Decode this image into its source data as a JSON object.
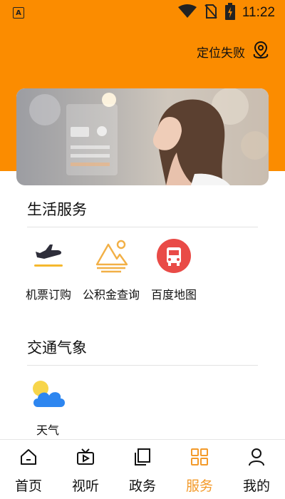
{
  "status_bar": {
    "time": "11:22",
    "left_icon": "A",
    "icons": [
      "wifi-icon",
      "no-sim-icon",
      "battery-charging-icon"
    ]
  },
  "header": {
    "location_text": "定位失败",
    "location_icon": "map-pin-icon"
  },
  "banner": {
    "description": "weather promotional banner with woman"
  },
  "sections": [
    {
      "title": "生活服务",
      "items": [
        {
          "label": "机票订购",
          "icon": "airplane-icon"
        },
        {
          "label": "公积金查询",
          "icon": "mountain-sun-icon"
        },
        {
          "label": "百度地图",
          "icon": "bus-icon"
        }
      ]
    },
    {
      "title": "交通气象",
      "items": [
        {
          "label": "天气",
          "icon": "weather-cloud-sun-icon"
        }
      ]
    }
  ],
  "bottom_nav": [
    {
      "label": "首页",
      "icon": "home-icon",
      "active": false
    },
    {
      "label": "视听",
      "icon": "tv-icon",
      "active": false
    },
    {
      "label": "政务",
      "icon": "copy-icon",
      "active": false
    },
    {
      "label": "服务",
      "icon": "grid-icon",
      "active": true
    },
    {
      "label": "我的",
      "icon": "user-icon",
      "active": false
    }
  ],
  "colors": {
    "primary": "#fb8c00",
    "active_tab": "#f39a2a",
    "map_red": "#e94b47",
    "plane_yellow": "#f5b82e",
    "weather_blue": "#2d86f0"
  }
}
